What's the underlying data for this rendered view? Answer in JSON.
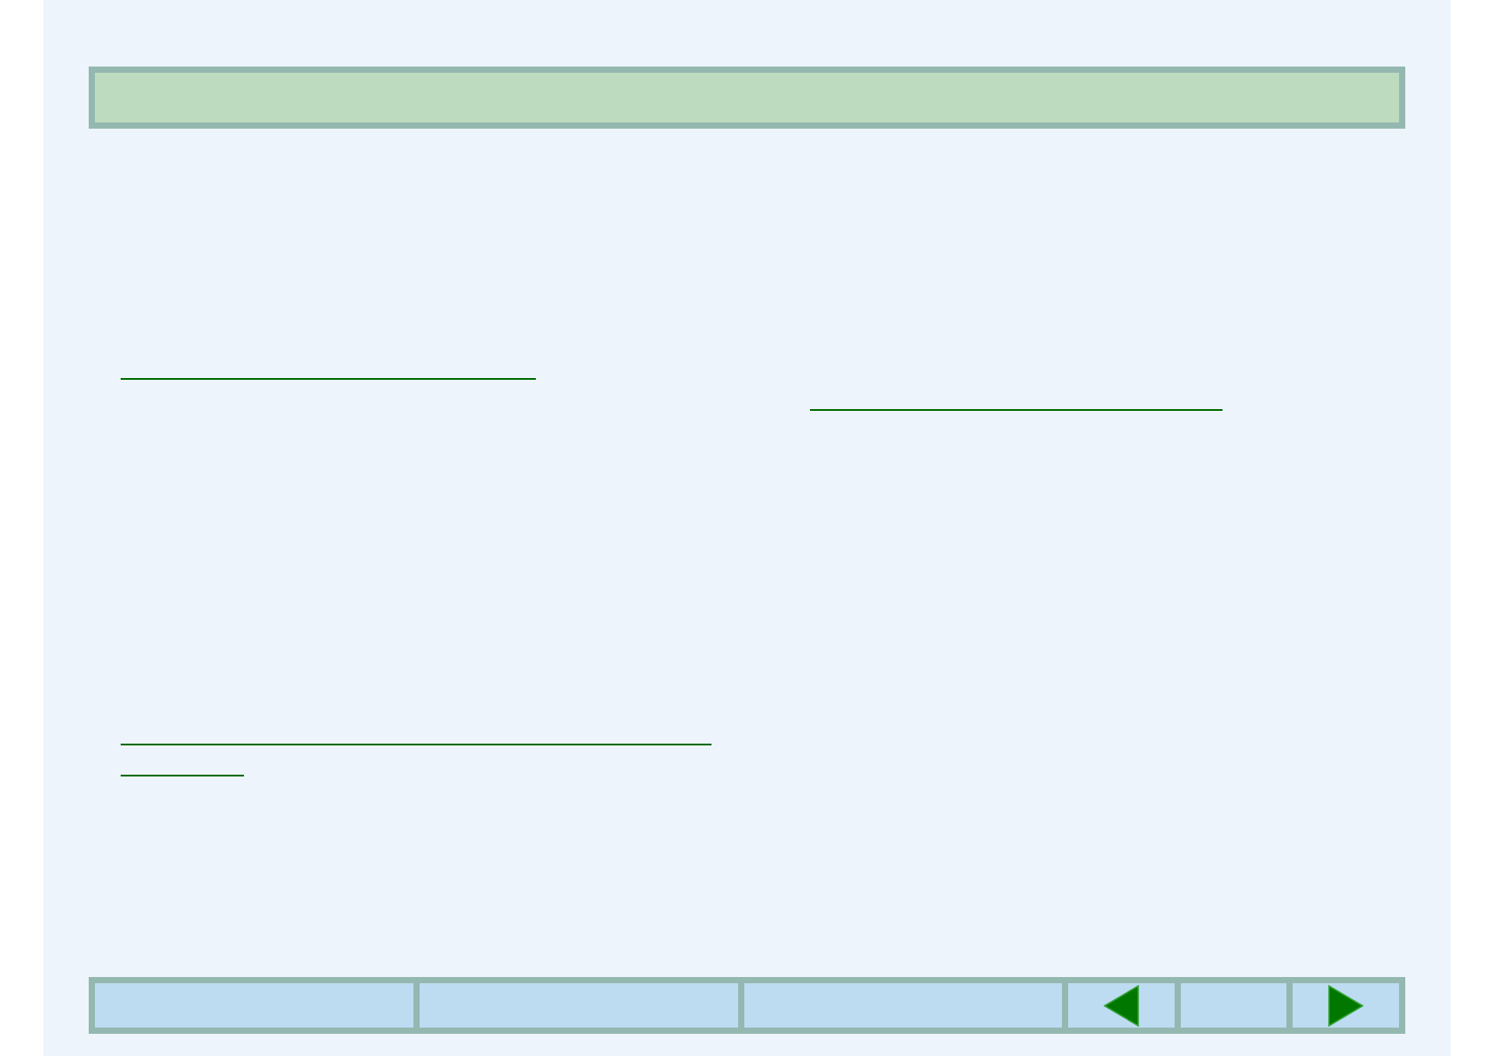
{
  "columns": [
    {
      "links": [
        {
          "segments": [
            {
              "kind": "underline"
            }
          ]
        },
        {
          "segments": [
            {
              "kind": "underline"
            },
            {
              "kind": "underline"
            }
          ]
        }
      ]
    },
    {
      "links": [
        {
          "segments": [
            {
              "kind": "underline"
            }
          ]
        }
      ]
    }
  ],
  "nav_bar": {
    "cells": [
      {
        "kind": "blank"
      },
      {
        "kind": "blank"
      },
      {
        "kind": "blank"
      },
      {
        "kind": "previous"
      },
      {
        "kind": "blank"
      },
      {
        "kind": "next"
      }
    ]
  }
}
